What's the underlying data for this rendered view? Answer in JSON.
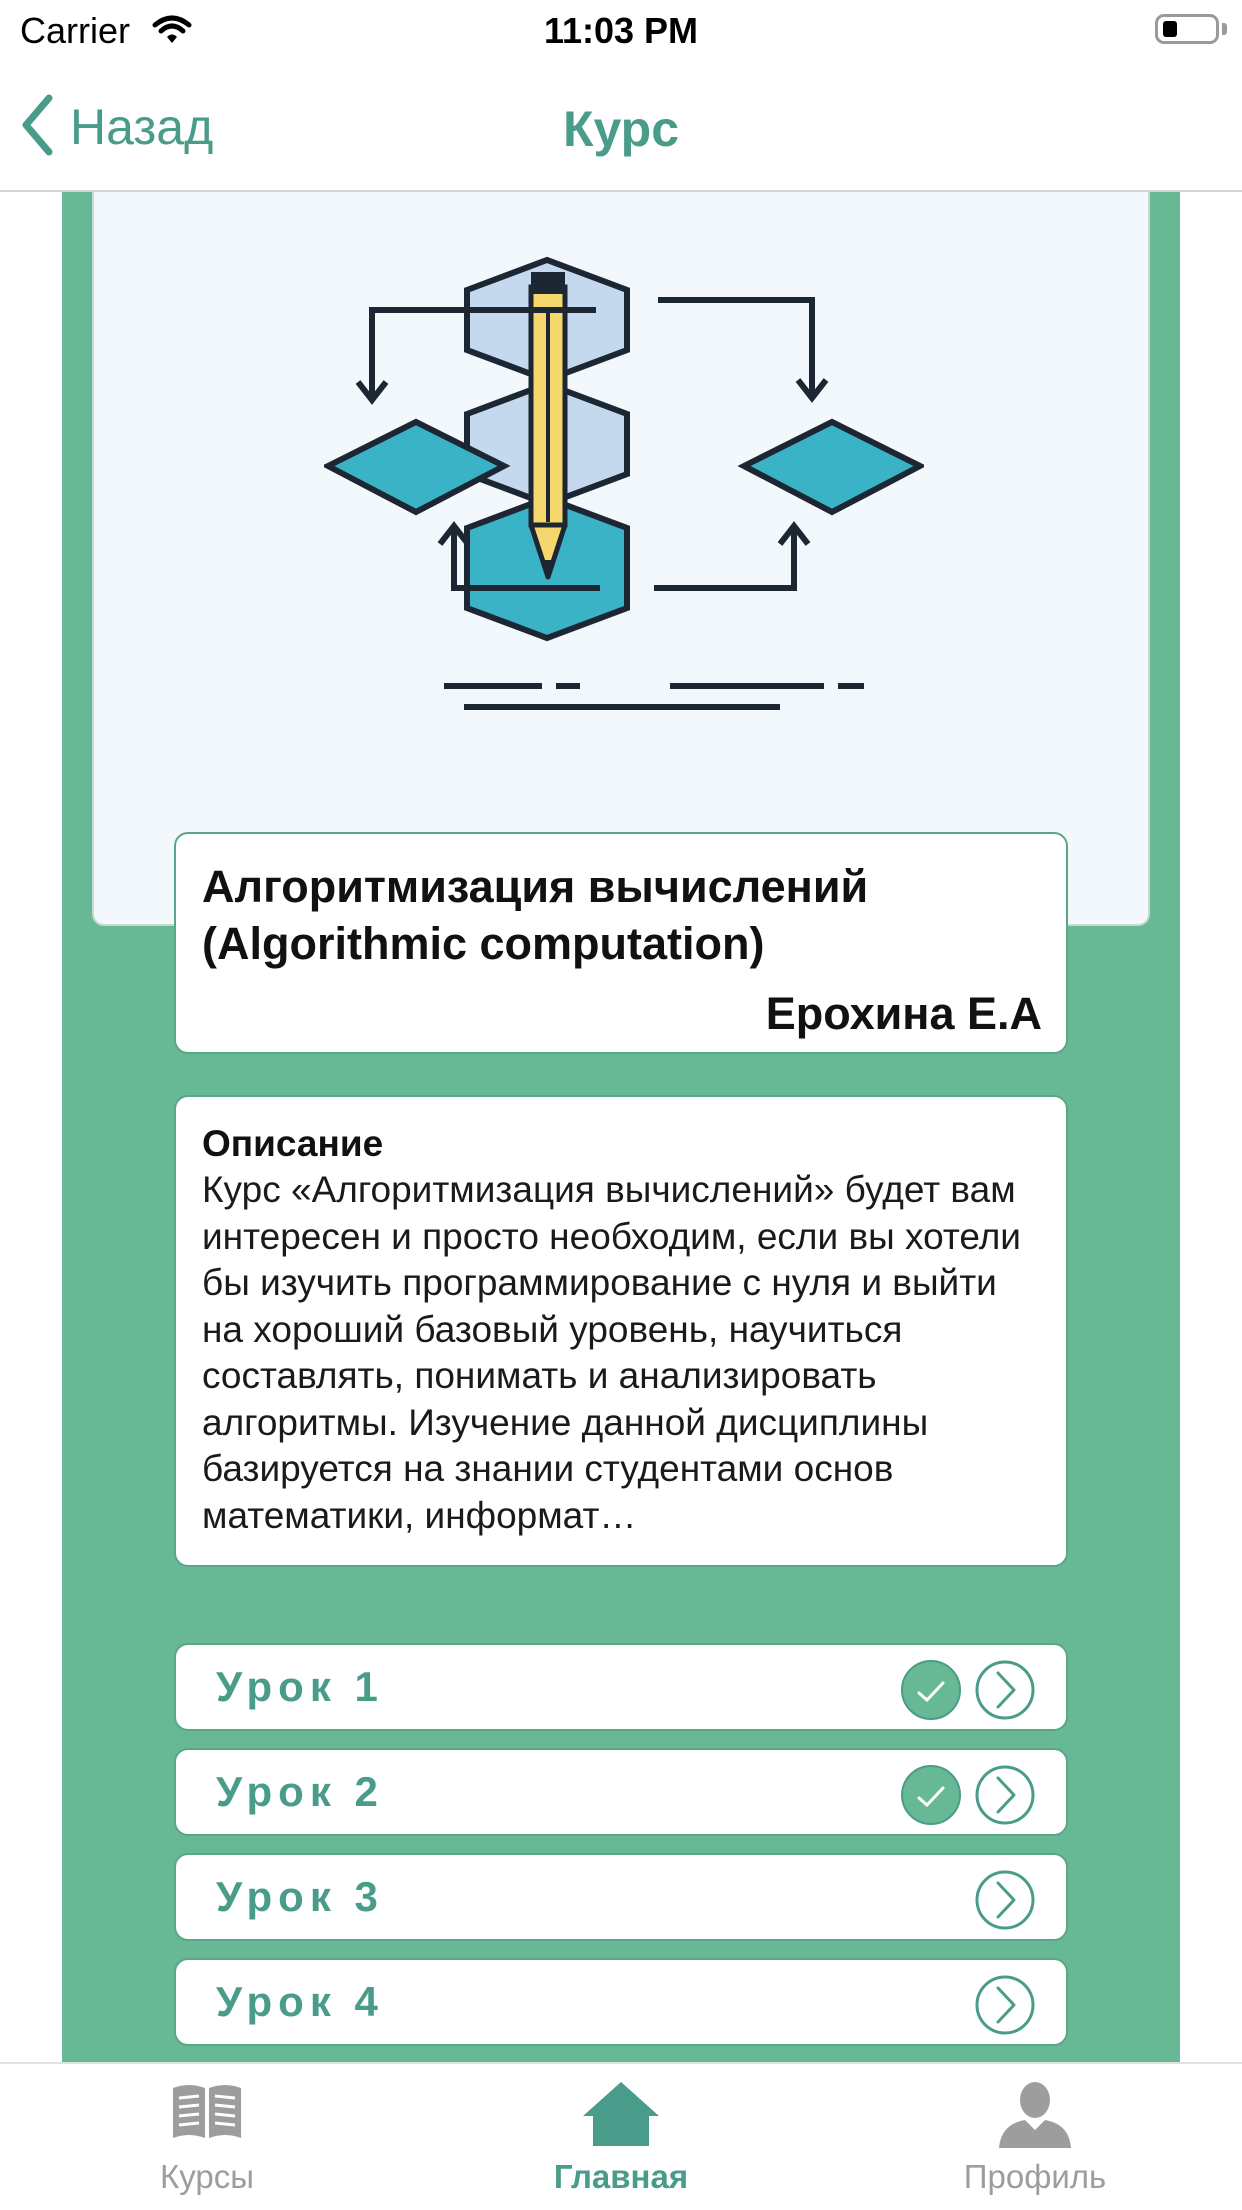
{
  "status_bar": {
    "carrier": "Carrier",
    "time": "11:03 PM"
  },
  "nav": {
    "back_label": "Назад",
    "title": "Курс"
  },
  "course": {
    "title_line1": "Алгоритмизация вычислений",
    "title_line2": "(Algorithmic computation)",
    "author": "Ерохина Е.А"
  },
  "description": {
    "heading": "Описание",
    "text": "Курс «Алгоритмизация вычислений» будет вам интересен и просто необходим, если вы хотели бы изучить программирование с нуля и выйти на хороший базовый уровень, научиться составлять, понимать и анализировать алгоритмы. Изучение данной дисциплины базируется на знании студентами основ математики, информат…"
  },
  "lessons": [
    {
      "label": "Урок  1",
      "completed": true
    },
    {
      "label": "Урок  2",
      "completed": true
    },
    {
      "label": "Урок  3",
      "completed": false
    },
    {
      "label": "Урок  4",
      "completed": false
    }
  ],
  "tabs": [
    {
      "label": "Курсы",
      "icon": "book-icon",
      "active": false
    },
    {
      "label": "Главная",
      "icon": "home-icon",
      "active": true
    },
    {
      "label": "Профиль",
      "icon": "person-icon",
      "active": false
    }
  ],
  "colors": {
    "accent": "#4a9c8a",
    "panel": "#67b996",
    "illustration_teal": "#3bb3c7",
    "illustration_light": "#c5d9ee",
    "pencil": "#f5d76e"
  }
}
